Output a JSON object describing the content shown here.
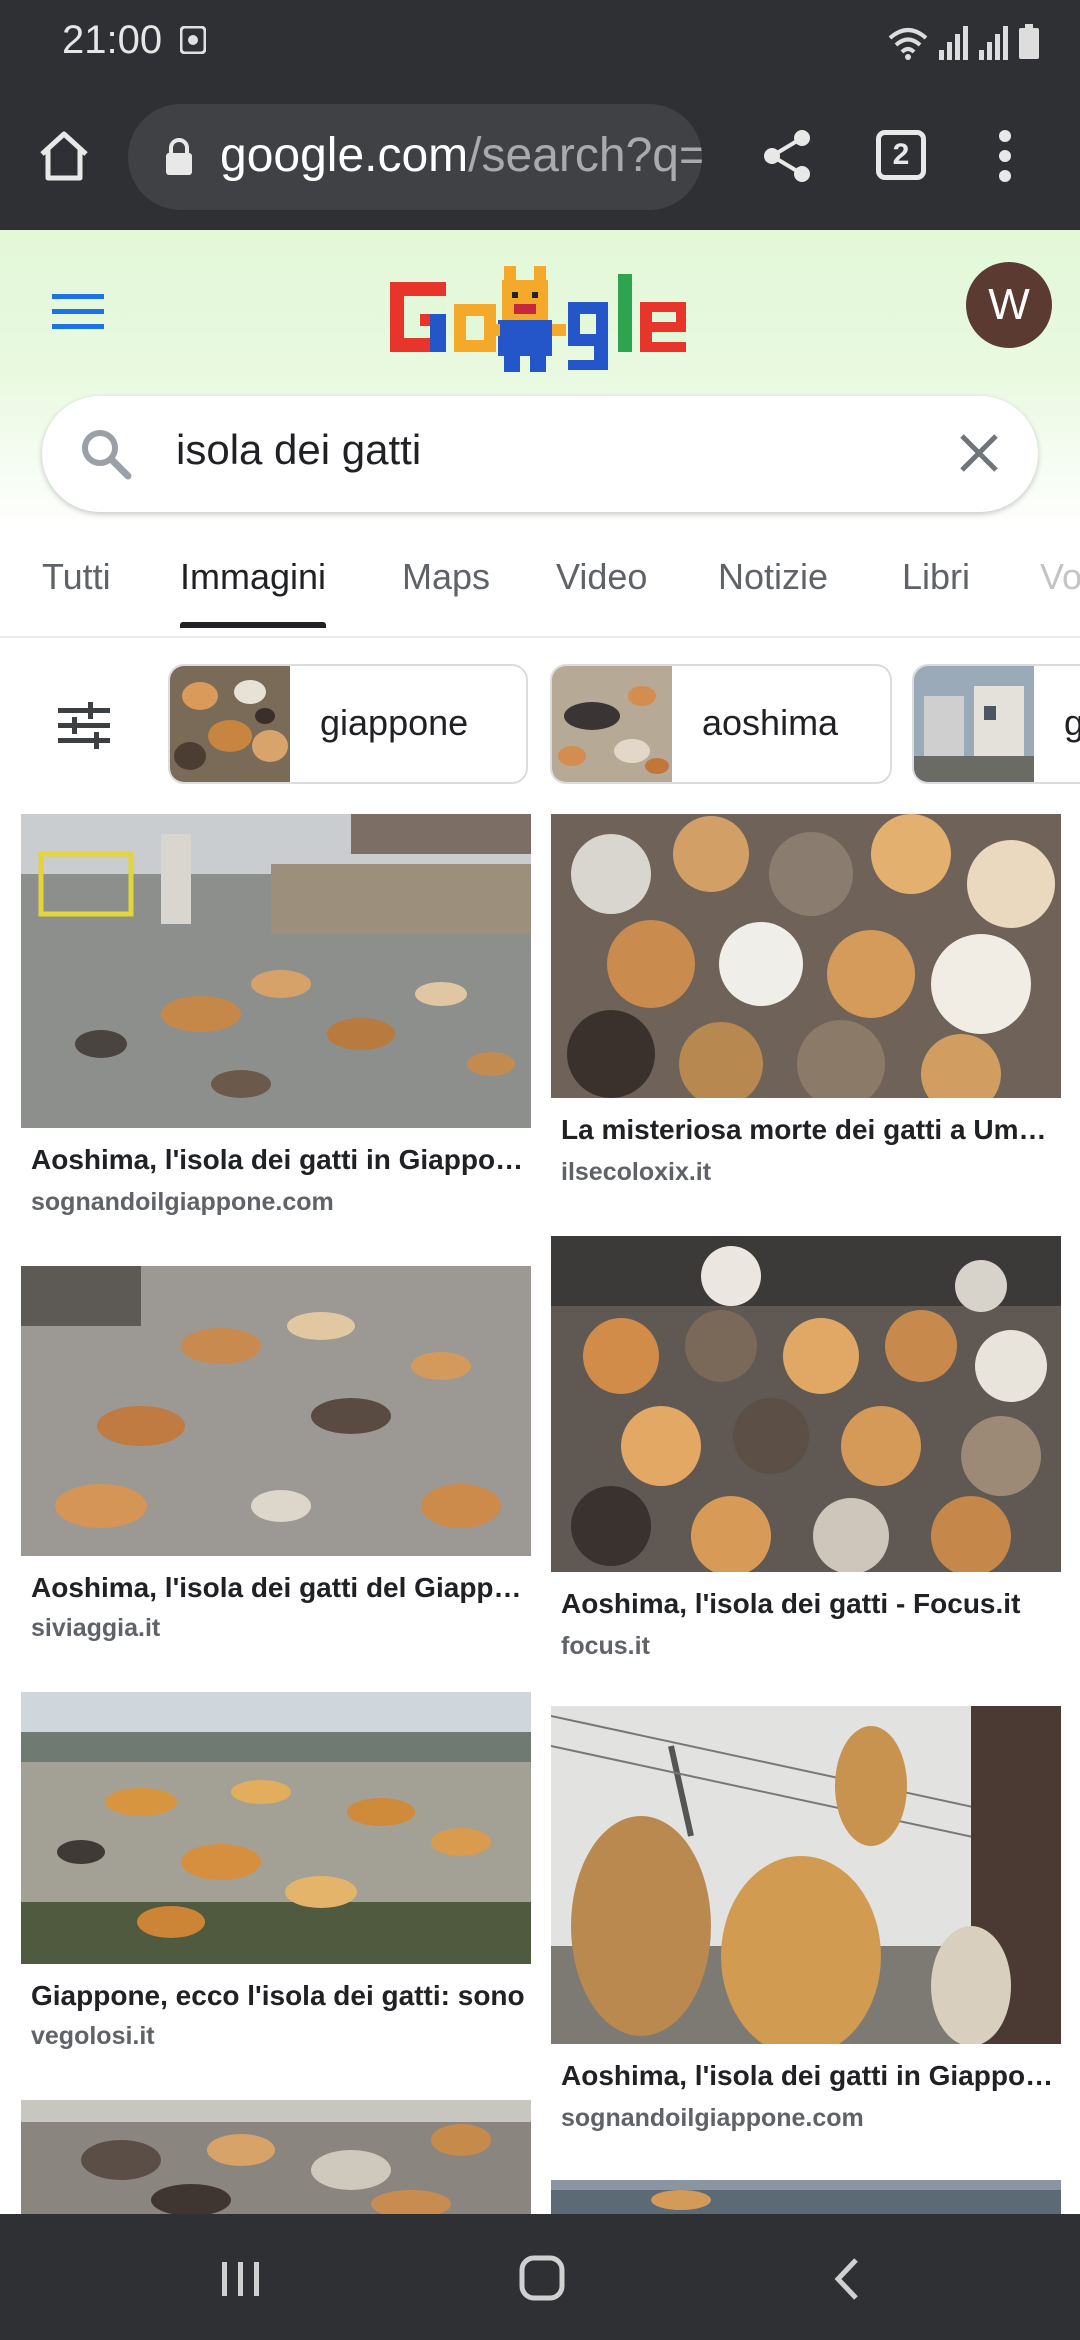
{
  "status_bar": {
    "time": "21:00",
    "icons": [
      "media-note-icon",
      "wifi-icon",
      "signal-icon",
      "signal-icon",
      "battery-icon"
    ]
  },
  "browser": {
    "url_host": "google.com",
    "url_path": "/search?q=",
    "tab_count": "2"
  },
  "header": {
    "avatar_letter": "W",
    "logo": "Google doodle (cat)"
  },
  "search": {
    "query": "isola dei gatti"
  },
  "tabs": [
    {
      "label": "Tutti"
    },
    {
      "label": "Immagini",
      "active": true
    },
    {
      "label": "Maps"
    },
    {
      "label": "Video"
    },
    {
      "label": "Notizie"
    },
    {
      "label": "Libri"
    },
    {
      "label": "Vo"
    }
  ],
  "chips": [
    {
      "label": "giappone"
    },
    {
      "label": "aoshima"
    },
    {
      "label": "g"
    }
  ],
  "results": [
    {
      "title": "Aoshima, l'isola dei gatti in Giappone",
      "source": "sognandoilgiappone.com"
    },
    {
      "title": "La misteriosa morte dei gatti a Umashima",
      "source": "ilsecoloxix.it"
    },
    {
      "title": "Aoshima, l'isola dei gatti del Giappone",
      "source": "siviaggia.it"
    },
    {
      "title": "Aoshima, l'isola dei gatti - Focus.it",
      "source": "focus.it"
    },
    {
      "title": "Giappone, ecco l'isola dei gatti: sono",
      "source": "vegolosi.it"
    },
    {
      "title": "Aoshima, l'isola dei gatti in Giappone",
      "source": "sognandoilgiappone.com"
    }
  ],
  "colors": {
    "chrome_bar": "#2f3033",
    "header_green": "#e3f8d8",
    "accent_blue": "#4285f4"
  }
}
